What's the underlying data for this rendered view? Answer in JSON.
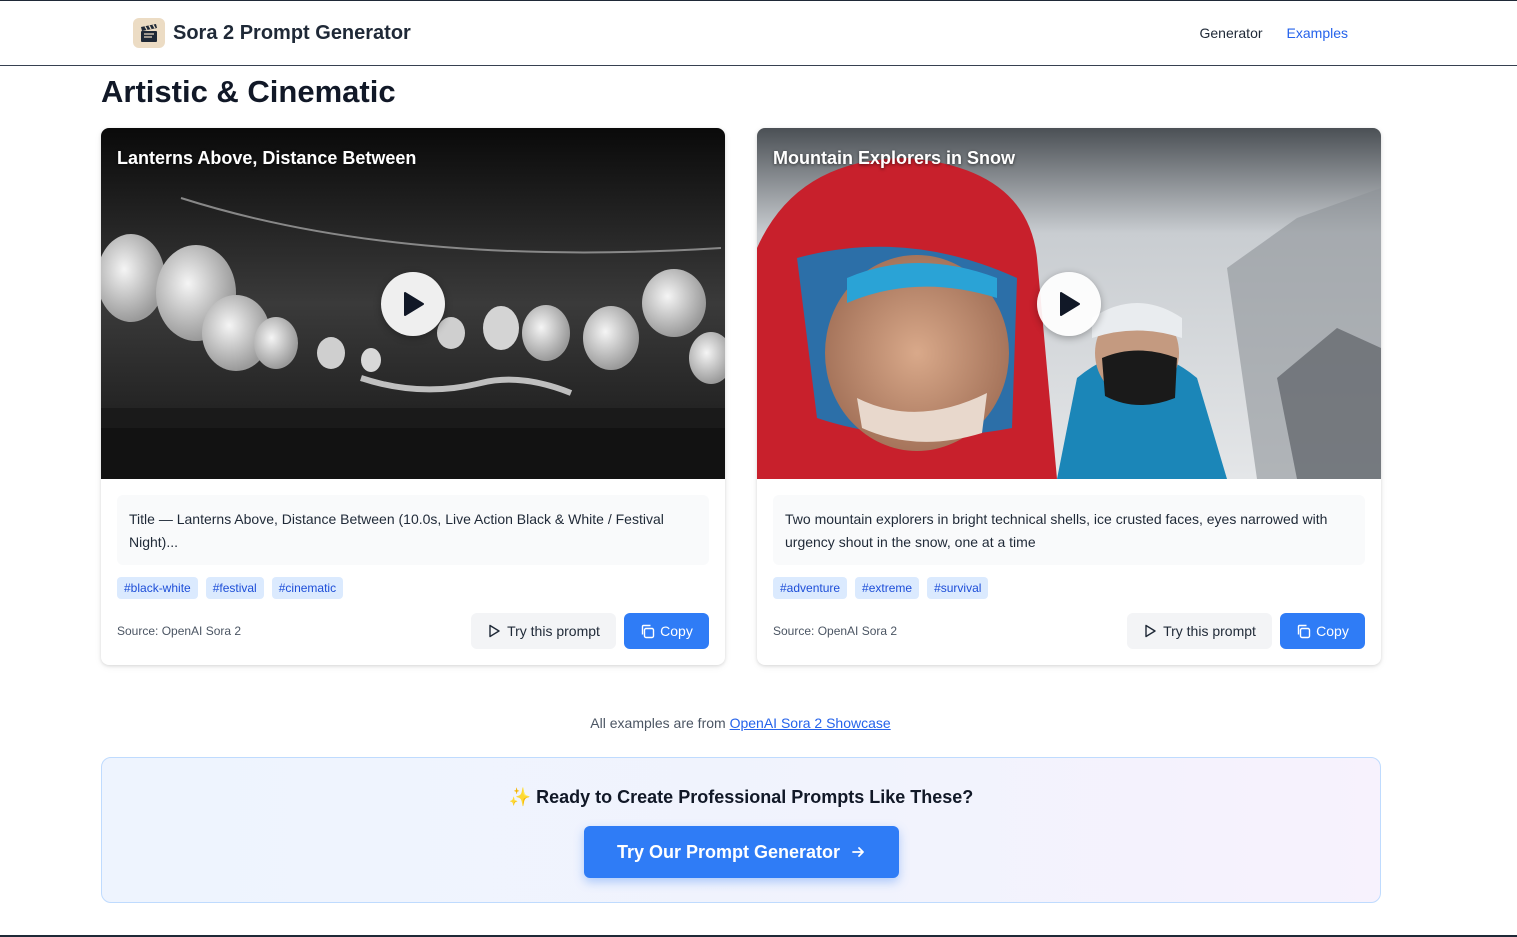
{
  "header": {
    "brand_icon": "clapperboard-icon",
    "brand_title": "Sora 2 Prompt Generator",
    "nav": [
      {
        "label": "Generator",
        "active": false
      },
      {
        "label": "Examples",
        "active": true
      }
    ]
  },
  "section": {
    "title": "Artistic & Cinematic"
  },
  "cards": [
    {
      "title": "Lanterns Above, Distance Between",
      "description": "Title — Lanterns Above, Distance Between (10.0s, Live Action Black & White / Festival Night)...",
      "tags": [
        "#black-white",
        "#festival",
        "#cinematic"
      ],
      "source": "Source: OpenAI Sora 2",
      "try_label": "Try this prompt",
      "copy_label": "Copy"
    },
    {
      "title": "Mountain Explorers in Snow",
      "description": "Two mountain explorers in bright technical shells, ice crusted faces, eyes narrowed with urgency shout in the snow, one at a time",
      "tags": [
        "#adventure",
        "#extreme",
        "#survival"
      ],
      "source": "Source: OpenAI Sora 2",
      "try_label": "Try this prompt",
      "copy_label": "Copy"
    }
  ],
  "credit": {
    "prefix": "All examples are from",
    "link": "OpenAI Sora 2 Showcase"
  },
  "cta": {
    "icon": "sparkles-icon",
    "title": "Ready to Create Professional Prompts Like These?",
    "button_label": "Try Our Prompt Generator",
    "button_icon": "arrow-right-icon"
  },
  "colors": {
    "accent": "#2f7cf6",
    "link": "#2563eb",
    "tag_bg": "#dbeafe",
    "tag_text": "#1d4ed8"
  }
}
